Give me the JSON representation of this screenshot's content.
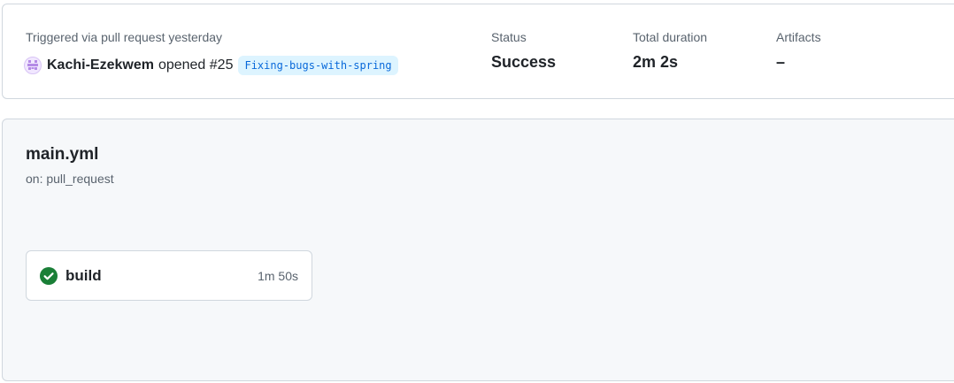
{
  "summary": {
    "trigger_label": "Triggered via pull request yesterday",
    "actor": "Kachi-Ezekwem",
    "action": "opened #25",
    "branch": "Fixing-bugs-with-spring",
    "status_label": "Status",
    "status_value": "Success",
    "duration_label": "Total duration",
    "duration_value": "2m 2s",
    "artifacts_label": "Artifacts",
    "artifacts_value": "–"
  },
  "workflow": {
    "name": "main.yml",
    "trigger": "on: pull_request",
    "jobs": [
      {
        "name": "build",
        "duration": "1m 50s",
        "status_icon": "check-circle-fill-icon",
        "status_color": "#1a7f37"
      }
    ]
  },
  "colors": {
    "success": "#1a7f37",
    "branch_text": "#0969da",
    "branch_bg": "#ddf4ff",
    "avatar": "#b48ae6"
  }
}
